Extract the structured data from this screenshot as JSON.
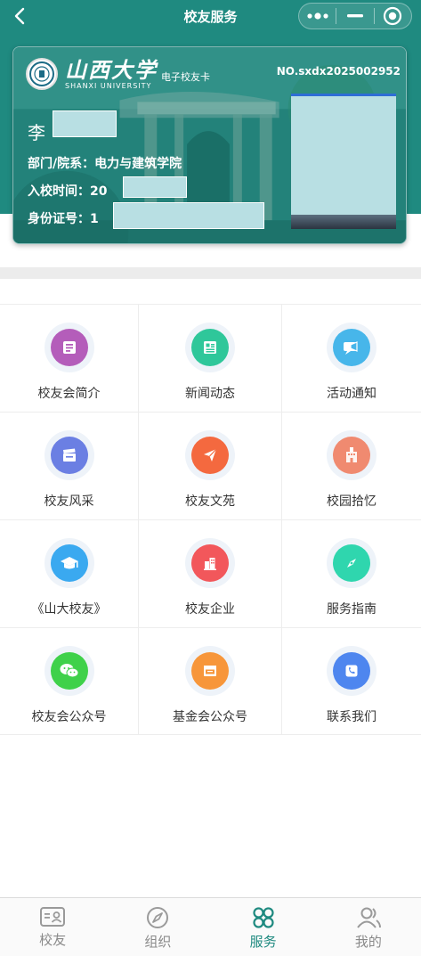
{
  "nav": {
    "title": "校友服务"
  },
  "card": {
    "school_name_cn": "山西大学",
    "school_name_en": "SHANXI UNIVERSITY",
    "card_type": "电子校友卡",
    "card_no": "NO.sxdx2025002952",
    "name_visible": "李",
    "department_label": "部门/院系：",
    "department_value": "电力与建筑学院",
    "enroll_label": "入校时间：",
    "enroll_value_visible": "20",
    "id_label": "身份证号：",
    "id_value_visible": "1"
  },
  "services": [
    {
      "label": "校友会简介",
      "icon": "book-icon",
      "color": "#b45dba"
    },
    {
      "label": "新闻动态",
      "icon": "newspaper-icon",
      "color": "#2fc79a"
    },
    {
      "label": "活动通知",
      "icon": "megaphone-icon",
      "color": "#47b6ea"
    },
    {
      "label": "校友风采",
      "icon": "clapperboard-icon",
      "color": "#6b7fe3"
    },
    {
      "label": "校友文苑",
      "icon": "paper-plane-icon",
      "color": "#f4693f"
    },
    {
      "label": "校园拾忆",
      "icon": "campus-building-icon",
      "color": "#f08a70"
    },
    {
      "label": "《山大校友》",
      "icon": "graduation-cap-icon",
      "color": "#3aa9f0"
    },
    {
      "label": "校友企业",
      "icon": "company-building-icon",
      "color": "#f2575b"
    },
    {
      "label": "服务指南",
      "icon": "compass-icon",
      "color": "#2fd6ae"
    },
    {
      "label": "校友会公众号",
      "icon": "wechat-icon",
      "color": "#3fd14a"
    },
    {
      "label": "基金会公众号",
      "icon": "certificate-icon",
      "color": "#f7963a"
    },
    {
      "label": "联系我们",
      "icon": "phone-icon",
      "color": "#4e86ef"
    }
  ],
  "tabbar": {
    "items": [
      {
        "label": "校友",
        "icon": "id-card-icon",
        "active": false
      },
      {
        "label": "组织",
        "icon": "compass-icon",
        "active": false
      },
      {
        "label": "服务",
        "icon": "grid-icon",
        "active": true
      },
      {
        "label": "我的",
        "icon": "user-icon",
        "active": false
      }
    ]
  },
  "colors": {
    "brand_teal": "#1f8a80",
    "mask_fill": "#b8dfe3",
    "text_dark": "#333333",
    "tab_inactive": "#8a8a8a"
  }
}
